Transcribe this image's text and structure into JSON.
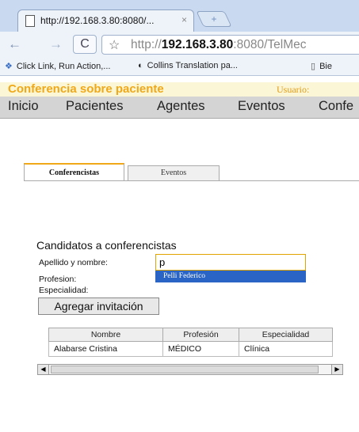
{
  "browser": {
    "tab_title": "http://192.168.3.80:8080/...",
    "tab_close": "×",
    "new_tab": "+",
    "back": "←",
    "forward": "→",
    "reload": "C",
    "bookmark_star": "☆",
    "url_scheme": "http://",
    "url_host": "192.168.3.80",
    "url_rest": ":8080/TelMec",
    "bookmarks": [
      {
        "label": "Click Link, Run Action,...",
        "icon": "plugin-icon",
        "glyph": "❖"
      },
      {
        "label": "Collins Translation pa...",
        "icon": "collins-icon",
        "glyph": "◐"
      },
      {
        "label": "Bie",
        "icon": "page-icon",
        "glyph": "▯"
      }
    ]
  },
  "app": {
    "title": "Conferencia sobre paciente",
    "user_label": "Usuario:",
    "menu": [
      "Inicio",
      "Pacientes",
      "Agentes",
      "Eventos",
      "Confe"
    ]
  },
  "tabs": [
    {
      "label": "Conferencistas",
      "active": true
    },
    {
      "label": "Eventos",
      "active": false
    }
  ],
  "form": {
    "section_title": "Candidatos a conferencistas",
    "name_label": "Apellido y nombre:",
    "name_value": "p",
    "suggestion": "Pelli Federico",
    "profesion_label": "Profesion:",
    "especialidad_label": "Especialidad:",
    "add_button": "Agregar invitación"
  },
  "table": {
    "headers": [
      "Nombre",
      "Profesión",
      "Especialidad"
    ],
    "rows": [
      [
        "Alabarse Cristina",
        "MÉDICO",
        "Clínica"
      ]
    ]
  },
  "scrollbar": {
    "left_arrow": "◀",
    "right_arrow": "▶"
  },
  "colors": {
    "accent": "#f0a818",
    "suggestion_bg": "#2a65c5",
    "menubar_bg": "#d4d4d4"
  }
}
